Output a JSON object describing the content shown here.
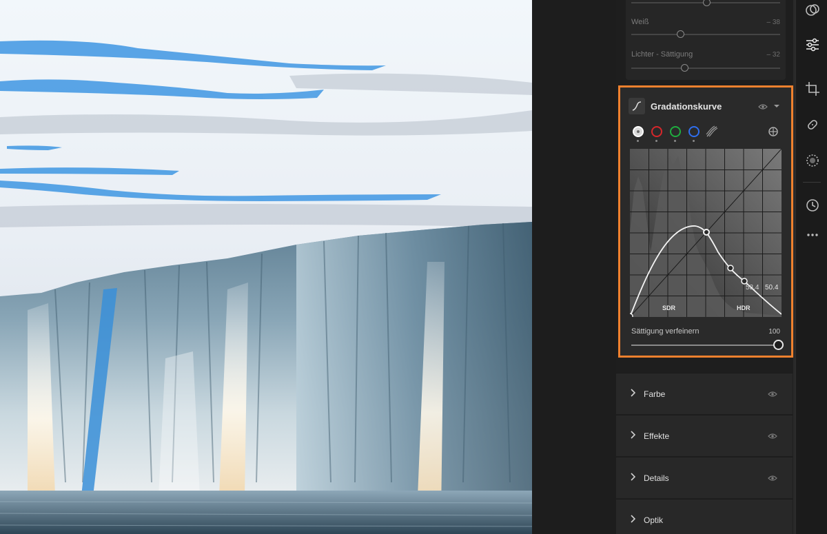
{
  "light_sliders": [
    {
      "label": "",
      "value": ""
    },
    {
      "label": "Weiß",
      "value": "– 38"
    },
    {
      "label": "Lichter - Sättigung",
      "value": "– 32"
    }
  ],
  "curve": {
    "title": "Gradationskurve",
    "channels": [
      {
        "icon": "point-curve-icon",
        "color": "#d9d9d9"
      },
      {
        "icon": "red-channel-icon",
        "color": "#d8272b"
      },
      {
        "icon": "green-channel-icon",
        "color": "#1fae3f"
      },
      {
        "icon": "blue-channel-icon",
        "color": "#2f6ff0"
      },
      {
        "icon": "parametric-curve-icon",
        "color": "#9a9a9a"
      }
    ],
    "readout_in": "53.4",
    "readout_out": "50.4",
    "zone_sdr": "SDR",
    "zone_hdr": "HDR",
    "saturation_label": "Sättigung verfeinern",
    "saturation_value": "100",
    "saturation_fraction": 1.0
  },
  "sections": [
    {
      "label": "Farbe"
    },
    {
      "label": "Effekte"
    },
    {
      "label": "Details"
    },
    {
      "label": "Optik"
    }
  ],
  "toolbar": {
    "icons": [
      "presets-icon",
      "edit-sliders-icon",
      "crop-icon",
      "healing-icon",
      "masking-icon",
      "history-icon",
      "more-icon"
    ]
  },
  "colors": {
    "highlight": "#f0812e",
    "panel": "#2a2a2a"
  }
}
